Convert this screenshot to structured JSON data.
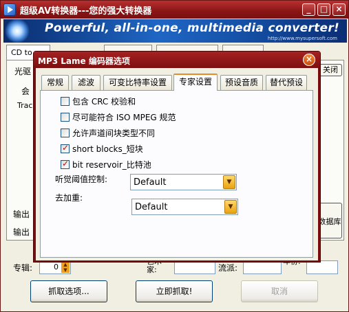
{
  "window": {
    "title": "超级AV转换器---您的强大转换器",
    "minimize": "_",
    "maximize": "□",
    "close": "×"
  },
  "banner": {
    "tagline": "Powerful, all-in-one, multimedia converter!",
    "url": "http://www.mysupersoft.com"
  },
  "main": {
    "tabs": [
      "CD to",
      "",
      "",
      ""
    ],
    "side_labels": [
      "光驱",
      "会",
      "Trac",
      "输出",
      "输出"
    ],
    "close_label": "关闭",
    "db_label": "数据库",
    "album_label": "专辑:",
    "album_value": "0",
    "artist_label": "艺术家:",
    "genre_label": "流派:",
    "year_label": "年份:",
    "buttons": {
      "grab_options": "抓取选项...",
      "grab_now": "立即抓取!",
      "cancel": "取消"
    }
  },
  "dialog": {
    "title": "MP3 Lame 编码器选项",
    "close": "×",
    "tabs": [
      "常规",
      "滤波",
      "可变比特率设置",
      "专家设置",
      "预设音质",
      "替代预设"
    ],
    "active_tab": "专家设置",
    "checkboxes": [
      {
        "label": "包含 CRC 校验和",
        "checked": false
      },
      {
        "label": "尽可能符合 ISO MPEG 规范",
        "checked": false
      },
      {
        "label": "允许声道间块类型不同",
        "checked": false
      },
      {
        "label": "short blocks_短块",
        "checked": true
      },
      {
        "label": "bit reservoir_比特池",
        "checked": true
      }
    ],
    "threshold_label": "听觉阈值控制:",
    "threshold_value": "Default",
    "emphasis_label": "去加重:",
    "emphasis_value": "Default"
  },
  "colors": {
    "titlebar": "#8a1515",
    "dialog_frame": "#7a0e0e",
    "active_tab_accent": "#e68b2c",
    "combo_arrow": "#e9a30f"
  }
}
